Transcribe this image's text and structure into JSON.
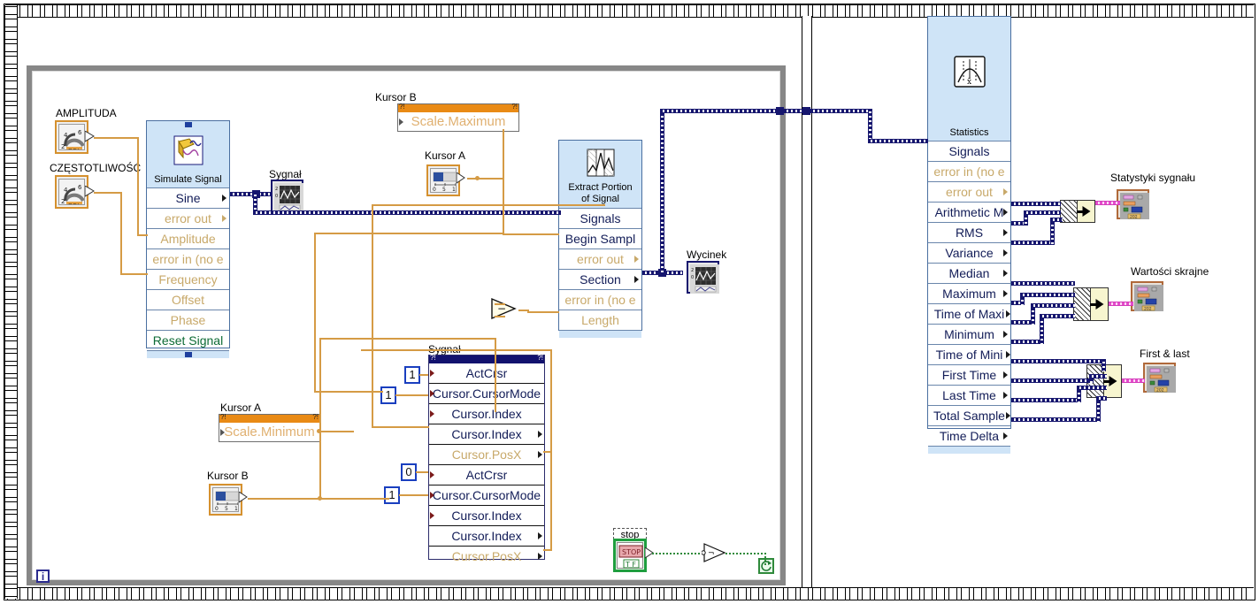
{
  "window": {
    "kind": "labview-block-diagram"
  },
  "controls": {
    "amplituda": {
      "label": "AMPLITUDA",
      "type": "knob-dbl",
      "terminal_type": "DBL"
    },
    "czestotliwosc": {
      "label": "CZĘSTOTLIWOŚĆ",
      "type": "knob-dbl",
      "terminal_type": "DBL"
    },
    "kursor_a_slider": {
      "label": "Kursor A",
      "type": "slider-dbl",
      "terminal_type": "DBL"
    },
    "kursor_b_slider": {
      "label": "Kursor B",
      "type": "slider-dbl",
      "terminal_type": "DBL"
    },
    "stop": {
      "label": "stop",
      "button_text": "STOP",
      "terminal_type": "TF"
    }
  },
  "property_nodes": {
    "kursor_b_max": {
      "label": "Kursor B",
      "rows": [
        "Scale.Maximum"
      ]
    },
    "kursor_a_min": {
      "label": "Kursor A",
      "rows": [
        "Scale.Minimum"
      ]
    },
    "sygnal_cursors": {
      "label": "Sygnał",
      "rows": [
        {
          "text": "ActCrsr",
          "dim": false,
          "dir": "in"
        },
        {
          "text": "Cursor.CursorMode",
          "dim": false,
          "dir": "in"
        },
        {
          "text": "Cursor.Index",
          "dim": false,
          "dir": "in"
        },
        {
          "text": "Cursor.Index",
          "dim": false,
          "dir": "out"
        },
        {
          "text": "Cursor.PosX",
          "dim": true,
          "dir": "out"
        },
        {
          "text": "ActCrsr",
          "dim": false,
          "dir": "in"
        },
        {
          "text": "Cursor.CursorMode",
          "dim": false,
          "dir": "in"
        },
        {
          "text": "Cursor.Index",
          "dim": false,
          "dir": "in"
        },
        {
          "text": "Cursor.Index",
          "dim": false,
          "dir": "out"
        },
        {
          "text": "Cursor.PosX",
          "dim": true,
          "dir": "out"
        }
      ]
    }
  },
  "constants": {
    "c1": "1",
    "c2": "1",
    "c3": "0",
    "c4": "1"
  },
  "express_vis": {
    "simulate_signal": {
      "title": "Simulate Signal",
      "icon": "simulate-signal-icon",
      "terminals": [
        {
          "text": "Sine",
          "style": "normal",
          "dir": "out"
        },
        {
          "text": "error out",
          "style": "dim",
          "dir": "out"
        },
        {
          "text": "Amplitude",
          "style": "dim",
          "dir": "in"
        },
        {
          "text": "error in (no e",
          "style": "dim",
          "dir": "in"
        },
        {
          "text": "Frequency",
          "style": "dim",
          "dir": "in"
        },
        {
          "text": "Offset",
          "style": "dim",
          "dir": "in"
        },
        {
          "text": "Phase",
          "style": "dim",
          "dir": "in"
        },
        {
          "text": "Reset Signal",
          "style": "green",
          "dir": "in"
        }
      ]
    },
    "extract_portion": {
      "title": "Extract Portion\nof Signal",
      "title_line1": "Extract Portion",
      "title_line2": "of Signal",
      "icon": "extract-portion-icon",
      "terminals": [
        {
          "text": "Signals",
          "style": "normal",
          "dir": "in"
        },
        {
          "text": "Begin Sampl",
          "style": "normal",
          "dir": "in"
        },
        {
          "text": "error out",
          "style": "dim",
          "dir": "out"
        },
        {
          "text": "Section",
          "style": "normal",
          "dir": "out"
        },
        {
          "text": "error in (no e",
          "style": "dim",
          "dir": "in"
        },
        {
          "text": "Length",
          "style": "dim",
          "dir": "in"
        }
      ]
    },
    "statistics": {
      "title": "Statistics",
      "icon": "statistics-icon",
      "terminals": [
        {
          "text": "Signals",
          "style": "normal",
          "dir": "in"
        },
        {
          "text": "error in (no e",
          "style": "dim",
          "dir": "in"
        },
        {
          "text": "error out",
          "style": "dim",
          "dir": "out"
        },
        {
          "text": "Arithmetic M",
          "style": "normal",
          "dir": "out"
        },
        {
          "text": "RMS",
          "style": "normal",
          "dir": "out"
        },
        {
          "text": "Variance",
          "style": "normal",
          "dir": "out"
        },
        {
          "text": "Median",
          "style": "normal",
          "dir": "out"
        },
        {
          "text": "Maximum",
          "style": "normal",
          "dir": "out"
        },
        {
          "text": "Time of Maxi",
          "style": "normal",
          "dir": "out"
        },
        {
          "text": "Minimum",
          "style": "normal",
          "dir": "out"
        },
        {
          "text": "Time of Mini",
          "style": "normal",
          "dir": "out"
        },
        {
          "text": "First Time",
          "style": "normal",
          "dir": "out"
        },
        {
          "text": "Last Time",
          "style": "normal",
          "dir": "out"
        },
        {
          "text": "Total Sample",
          "style": "normal",
          "dir": "out"
        },
        {
          "text": "Time Delta",
          "style": "normal",
          "dir": "out"
        }
      ]
    }
  },
  "indicators": {
    "sygnal_graph": {
      "label": "Sygnał",
      "type": "waveform-graph"
    },
    "wycinek_graph": {
      "label": "Wycinek",
      "type": "waveform-graph"
    },
    "statystyki_sygnalu": {
      "label": "Statystyki sygnału",
      "type": "express-table"
    },
    "wartosci_skrajne": {
      "label": "Wartości skrajne",
      "type": "express-table"
    },
    "first_and_last": {
      "label": "First & last",
      "type": "express-table"
    }
  },
  "functions": {
    "subtract": {
      "label": "subtract-function",
      "glyph": "−"
    },
    "not_gate": {
      "label": "not-function",
      "glyph": "¬"
    },
    "merge_1": {
      "label": "merge-signals"
    },
    "merge_2": {
      "label": "merge-signals"
    },
    "merge_3": {
      "label": "merge-signals"
    }
  },
  "misc": {
    "info_badge": "i",
    "loop_condition": "↻"
  },
  "colors": {
    "express_header": "#cfe4f7",
    "express_border": "#4a6fa0",
    "dynamic_wire": "#16166e",
    "orange_wire": "#d59b45",
    "pink_wire": "#e44bcb",
    "green_wire": "#2f8a3b",
    "loop_border": "#878787",
    "control_border": "#d5912f"
  }
}
